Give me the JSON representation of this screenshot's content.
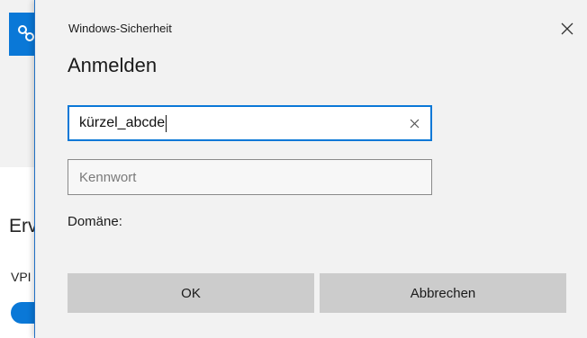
{
  "background_window": {
    "heading_fragment": "Erv",
    "sub_fragment": "VPI",
    "accent_color": "#0a78d7",
    "tile_icon": "network-icon"
  },
  "dialog": {
    "title": "Windows-Sicherheit",
    "heading": "Anmelden",
    "close_icon": "close-icon",
    "username": {
      "value": "kürzel_abcde",
      "clear_icon": "clear-icon",
      "focused": true
    },
    "password": {
      "placeholder": "Kennwort",
      "value": ""
    },
    "domain_label": "Domäne:",
    "ok_label": "OK",
    "cancel_label": "Abbrechen"
  },
  "colors": {
    "focus_border": "#0a78d7",
    "dialog_bg": "#f2f2f2",
    "button_bg": "#cccccc"
  }
}
